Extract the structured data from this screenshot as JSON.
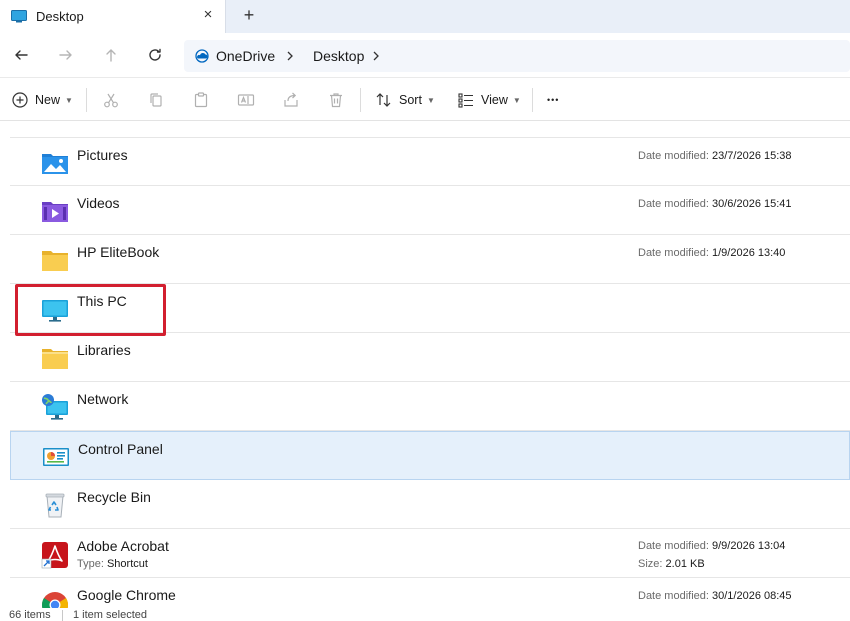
{
  "tab": {
    "title": "Desktop",
    "close_glyph": "×",
    "new_tab_glyph": "+"
  },
  "address": {
    "crumbs": [
      "OneDrive",
      "Desktop"
    ]
  },
  "toolbar": {
    "new_label": "New",
    "sort_label": "Sort",
    "view_label": "View",
    "more_glyph": "•••"
  },
  "items": [
    {
      "name": "Pictures",
      "icon": "pictures-folder-icon",
      "date_label": "Date modified:",
      "date": "23/7/2026 15:38"
    },
    {
      "name": "Videos",
      "icon": "videos-folder-icon",
      "date_label": "Date modified:",
      "date": "30/6/2026 15:41"
    },
    {
      "name": "HP EliteBook",
      "icon": "folder-icon",
      "date_label": "Date modified:",
      "date": "1/9/2026 13:40"
    },
    {
      "name": "This PC",
      "icon": "this-pc-icon"
    },
    {
      "name": "Libraries",
      "icon": "libraries-icon"
    },
    {
      "name": "Network",
      "icon": "network-icon"
    },
    {
      "name": "Control Panel",
      "icon": "control-panel-icon",
      "selected": true
    },
    {
      "name": "Recycle Bin",
      "icon": "recycle-bin-icon"
    },
    {
      "name": "Adobe Acrobat",
      "icon": "adobe-acrobat-icon",
      "type_label": "Type:",
      "type": "Shortcut",
      "date_label": "Date modified:",
      "date": "9/9/2026 13:04",
      "size_label": "Size:",
      "size": "2.01 KB"
    },
    {
      "name": "Google Chrome",
      "icon": "google-chrome-icon",
      "date_label": "Date modified:",
      "date": "30/1/2026 08:45"
    }
  ],
  "status": {
    "count": "66 items",
    "selected": "1 item selected"
  },
  "colors": {
    "accent": "#0067c0",
    "highlight_box": "#d21f2f",
    "selection": "#e5f0fb"
  }
}
